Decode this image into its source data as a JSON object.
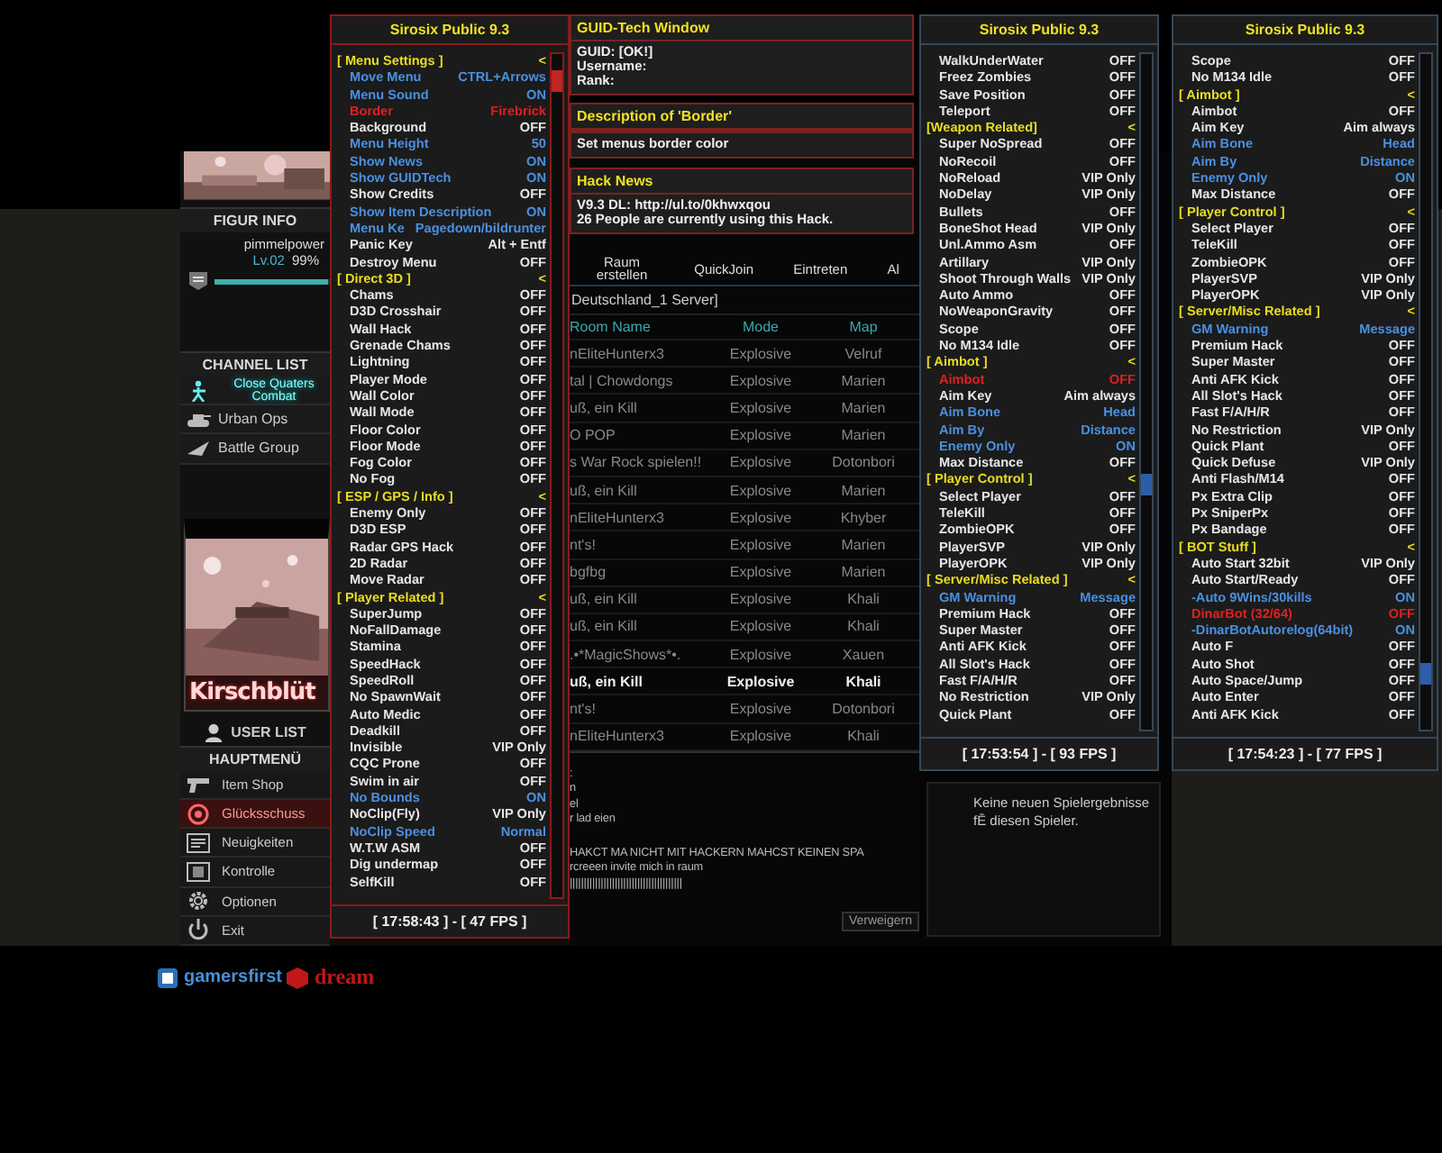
{
  "menus": [
    {
      "title": "Sirosix Public 9.3",
      "color": "#8b1a1a",
      "footer": "[ 17:58:43 ] - [ 47 FPS ]",
      "rows": [
        {
          "kind": "section",
          "label": "[ Menu Settings ]",
          "value": "<"
        },
        {
          "kind": "option",
          "label": "Move Menu",
          "value": "CTRL+Arrows",
          "active": true,
          "selected": false
        },
        {
          "kind": "option",
          "label": "Menu Sound",
          "value": "ON",
          "active": true,
          "selected": false
        },
        {
          "kind": "option",
          "label": "Border",
          "value": "Firebrick",
          "active": false,
          "selected": true
        },
        {
          "kind": "option",
          "label": "Background",
          "value": "OFF",
          "active": false,
          "selected": false
        },
        {
          "kind": "option",
          "label": "Menu Height",
          "value": "50",
          "active": true,
          "selected": false
        },
        {
          "kind": "option",
          "label": "Show News",
          "value": "ON",
          "active": true,
          "selected": false
        },
        {
          "kind": "option",
          "label": "Show GUIDTech",
          "value": "ON",
          "active": true,
          "selected": false
        },
        {
          "kind": "option",
          "label": "Show Credits",
          "value": "OFF",
          "active": false,
          "selected": false
        },
        {
          "kind": "option",
          "label": "Show Item Description",
          "value": "ON",
          "active": true,
          "selected": false
        },
        {
          "kind": "option",
          "label": "Menu Ke",
          "value": "Pagedown/bildrunter",
          "active": true,
          "selected": false
        },
        {
          "kind": "option",
          "label": "Panic Key",
          "value": "Alt + Entf",
          "active": false,
          "selected": false
        },
        {
          "kind": "option",
          "label": "Destroy Menu",
          "value": "OFF",
          "active": false,
          "selected": false
        },
        {
          "kind": "section",
          "label": "[ Direct 3D ]",
          "value": "<"
        },
        {
          "kind": "option",
          "label": "Chams",
          "value": "OFF",
          "active": false,
          "selected": false
        },
        {
          "kind": "option",
          "label": "D3D Crosshair",
          "value": "OFF",
          "active": false,
          "selected": false
        },
        {
          "kind": "option",
          "label": "Wall Hack",
          "value": "OFF",
          "active": false,
          "selected": false
        },
        {
          "kind": "option",
          "label": "Grenade Chams",
          "value": "OFF",
          "active": false,
          "selected": false
        },
        {
          "kind": "option",
          "label": "Lightning",
          "value": "OFF",
          "active": false,
          "selected": false
        },
        {
          "kind": "option",
          "label": "Player Mode",
          "value": "OFF",
          "active": false,
          "selected": false
        },
        {
          "kind": "option",
          "label": "Wall Color",
          "value": "OFF",
          "active": false,
          "selected": false
        },
        {
          "kind": "option",
          "label": "Wall Mode",
          "value": "OFF",
          "active": false,
          "selected": false
        },
        {
          "kind": "option",
          "label": "Floor Color",
          "value": "OFF",
          "active": false,
          "selected": false
        },
        {
          "kind": "option",
          "label": "Floor Mode",
          "value": "OFF",
          "active": false,
          "selected": false
        },
        {
          "kind": "option",
          "label": "Fog Color",
          "value": "OFF",
          "active": false,
          "selected": false
        },
        {
          "kind": "option",
          "label": "No Fog",
          "value": "OFF",
          "active": false,
          "selected": false
        },
        {
          "kind": "section",
          "label": "[ ESP / GPS / Info ]",
          "value": "<"
        },
        {
          "kind": "option",
          "label": "Enemy Only",
          "value": "OFF",
          "active": false,
          "selected": false
        },
        {
          "kind": "option",
          "label": "D3D ESP",
          "value": "OFF",
          "active": false,
          "selected": false
        },
        {
          "kind": "option",
          "label": "Radar GPS Hack",
          "value": "OFF",
          "active": false,
          "selected": false
        },
        {
          "kind": "option",
          "label": "2D Radar",
          "value": "OFF",
          "active": false,
          "selected": false
        },
        {
          "kind": "option",
          "label": "Move Radar",
          "value": "OFF",
          "active": false,
          "selected": false
        },
        {
          "kind": "section",
          "label": "[ Player Related ]",
          "value": "<"
        },
        {
          "kind": "option",
          "label": "SuperJump",
          "value": "OFF",
          "active": false,
          "selected": false
        },
        {
          "kind": "option",
          "label": "NoFallDamage",
          "value": "OFF",
          "active": false,
          "selected": false
        },
        {
          "kind": "option",
          "label": "Stamina",
          "value": "OFF",
          "active": false,
          "selected": false
        },
        {
          "kind": "option",
          "label": "SpeedHack",
          "value": "OFF",
          "active": false,
          "selected": false
        },
        {
          "kind": "option",
          "label": "SpeedRoll",
          "value": "OFF",
          "active": false,
          "selected": false
        },
        {
          "kind": "option",
          "label": "No SpawnWait",
          "value": "OFF",
          "active": false,
          "selected": false
        },
        {
          "kind": "option",
          "label": "Auto Medic",
          "value": "OFF",
          "active": false,
          "selected": false
        },
        {
          "kind": "option",
          "label": "Deadkill",
          "value": "OFF",
          "active": false,
          "selected": false
        },
        {
          "kind": "option",
          "label": "Invisible",
          "value": "VIP Only",
          "active": false,
          "selected": false
        },
        {
          "kind": "option",
          "label": "CQC Prone",
          "value": "OFF",
          "active": false,
          "selected": false
        },
        {
          "kind": "option",
          "label": "Swim in air",
          "value": "OFF",
          "active": false,
          "selected": false
        },
        {
          "kind": "option",
          "label": "No Bounds",
          "value": "ON",
          "active": true,
          "selected": false
        },
        {
          "kind": "option",
          "label": "NoClip(Fly)",
          "value": "VIP Only",
          "active": false,
          "selected": false
        },
        {
          "kind": "option",
          "label": "NoClip Speed",
          "value": "Normal",
          "active": true,
          "selected": false
        },
        {
          "kind": "option",
          "label": "W.T.W ASM",
          "value": "OFF",
          "active": false,
          "selected": false
        },
        {
          "kind": "option",
          "label": "Dig undermap",
          "value": "OFF",
          "active": false,
          "selected": false
        },
        {
          "kind": "option",
          "label": "SelfKill",
          "value": "OFF",
          "active": false,
          "selected": false
        }
      ]
    },
    {
      "title": "Sirosix Public 9.3",
      "color": "#34485a",
      "footer": "[ 17:53:54 ] - [ 93 FPS ]",
      "rows": [
        {
          "kind": "option",
          "label": "WalkUnderWater",
          "value": "OFF",
          "active": false,
          "selected": false
        },
        {
          "kind": "option",
          "label": "Freez Zombies",
          "value": "OFF",
          "active": false,
          "selected": false
        },
        {
          "kind": "option",
          "label": "Save Position",
          "value": "OFF",
          "active": false,
          "selected": false
        },
        {
          "kind": "option",
          "label": "Teleport",
          "value": "OFF",
          "active": false,
          "selected": false
        },
        {
          "kind": "section",
          "label": "[Weapon Related]",
          "value": "<"
        },
        {
          "kind": "option",
          "label": "Super NoSpread",
          "value": "OFF",
          "active": false,
          "selected": false
        },
        {
          "kind": "option",
          "label": "NoRecoil",
          "value": "OFF",
          "active": false,
          "selected": false
        },
        {
          "kind": "option",
          "label": "NoReload",
          "value": "VIP Only",
          "active": false,
          "selected": false
        },
        {
          "kind": "option",
          "label": "NoDelay",
          "value": "VIP Only",
          "active": false,
          "selected": false
        },
        {
          "kind": "option",
          "label": "Bullets",
          "value": "OFF",
          "active": false,
          "selected": false
        },
        {
          "kind": "option",
          "label": "BoneShot Head",
          "value": "VIP Only",
          "active": false,
          "selected": false
        },
        {
          "kind": "option",
          "label": "Unl.Ammo Asm",
          "value": "OFF",
          "active": false,
          "selected": false
        },
        {
          "kind": "option",
          "label": "Artillary",
          "value": "VIP Only",
          "active": false,
          "selected": false
        },
        {
          "kind": "option",
          "label": "Shoot Through Walls",
          "value": "VIP Only",
          "active": false,
          "selected": false
        },
        {
          "kind": "option",
          "label": "Auto Ammo",
          "value": "OFF",
          "active": false,
          "selected": false
        },
        {
          "kind": "option",
          "label": "NoWeaponGravity",
          "value": "OFF",
          "active": false,
          "selected": false
        },
        {
          "kind": "option",
          "label": "Scope",
          "value": "OFF",
          "active": false,
          "selected": false
        },
        {
          "kind": "option",
          "label": "No M134 Idle",
          "value": "OFF",
          "active": false,
          "selected": false
        },
        {
          "kind": "section",
          "label": "[ Aimbot ]",
          "value": "<"
        },
        {
          "kind": "option",
          "label": "Aimbot",
          "value": "OFF",
          "active": false,
          "selected": true
        },
        {
          "kind": "option",
          "label": "Aim Key",
          "value": "Aim always",
          "active": false,
          "selected": false
        },
        {
          "kind": "option",
          "label": "Aim Bone",
          "value": "Head",
          "active": true,
          "selected": false
        },
        {
          "kind": "option",
          "label": "Aim By",
          "value": "Distance",
          "active": true,
          "selected": false
        },
        {
          "kind": "option",
          "label": "Enemy Only",
          "value": "ON",
          "active": true,
          "selected": false
        },
        {
          "kind": "option",
          "label": "Max Distance",
          "value": "OFF",
          "active": false,
          "selected": false
        },
        {
          "kind": "section",
          "label": "[ Player Control ]",
          "value": "<"
        },
        {
          "kind": "option",
          "label": "Select Player",
          "value": "OFF",
          "active": false,
          "selected": false
        },
        {
          "kind": "option",
          "label": "TeleKill",
          "value": "OFF",
          "active": false,
          "selected": false
        },
        {
          "kind": "option",
          "label": "ZombieOPK",
          "value": "OFF",
          "active": false,
          "selected": false
        },
        {
          "kind": "option",
          "label": "PlayerSVP",
          "value": "VIP Only",
          "active": false,
          "selected": false
        },
        {
          "kind": "option",
          "label": "PlayerOPK",
          "value": "VIP Only",
          "active": false,
          "selected": false
        },
        {
          "kind": "section",
          "label": "[ Server/Misc Related ]",
          "value": "<"
        },
        {
          "kind": "option",
          "label": "GM Warning",
          "value": "Message",
          "active": true,
          "selected": false
        },
        {
          "kind": "option",
          "label": "Premium Hack",
          "value": "OFF",
          "active": false,
          "selected": false
        },
        {
          "kind": "option",
          "label": "Super Master",
          "value": "OFF",
          "active": false,
          "selected": false
        },
        {
          "kind": "option",
          "label": "Anti AFK Kick",
          "value": "OFF",
          "active": false,
          "selected": false
        },
        {
          "kind": "option",
          "label": "All Slot's Hack",
          "value": "OFF",
          "active": false,
          "selected": false
        },
        {
          "kind": "option",
          "label": "Fast F/A/H/R",
          "value": "OFF",
          "active": false,
          "selected": false
        },
        {
          "kind": "option",
          "label": "No Restriction",
          "value": "VIP Only",
          "active": false,
          "selected": false
        },
        {
          "kind": "option",
          "label": "Quick Plant",
          "value": "OFF",
          "active": false,
          "selected": false
        }
      ]
    },
    {
      "title": "Sirosix Public 9.3",
      "color": "#34485a",
      "footer": "[ 17:54:23 ] - [ 77 FPS ]",
      "rows": [
        {
          "kind": "option",
          "label": "Scope",
          "value": "OFF",
          "active": false,
          "selected": false
        },
        {
          "kind": "option",
          "label": "No M134 Idle",
          "value": "OFF",
          "active": false,
          "selected": false
        },
        {
          "kind": "section",
          "label": "[ Aimbot ]",
          "value": "<"
        },
        {
          "kind": "option",
          "label": "Aimbot",
          "value": "OFF",
          "active": false,
          "selected": false
        },
        {
          "kind": "option",
          "label": "Aim Key",
          "value": "Aim always",
          "active": false,
          "selected": false
        },
        {
          "kind": "option",
          "label": "Aim Bone",
          "value": "Head",
          "active": true,
          "selected": false
        },
        {
          "kind": "option",
          "label": "Aim By",
          "value": "Distance",
          "active": true,
          "selected": false
        },
        {
          "kind": "option",
          "label": "Enemy Only",
          "value": "ON",
          "active": true,
          "selected": false
        },
        {
          "kind": "option",
          "label": "Max Distance",
          "value": "OFF",
          "active": false,
          "selected": false
        },
        {
          "kind": "section",
          "label": "[ Player Control ]",
          "value": "<"
        },
        {
          "kind": "option",
          "label": "Select Player",
          "value": "OFF",
          "active": false,
          "selected": false
        },
        {
          "kind": "option",
          "label": "TeleKill",
          "value": "OFF",
          "active": false,
          "selected": false
        },
        {
          "kind": "option",
          "label": "ZombieOPK",
          "value": "OFF",
          "active": false,
          "selected": false
        },
        {
          "kind": "option",
          "label": "PlayerSVP",
          "value": "VIP Only",
          "active": false,
          "selected": false
        },
        {
          "kind": "option",
          "label": "PlayerOPK",
          "value": "VIP Only",
          "active": false,
          "selected": false
        },
        {
          "kind": "section",
          "label": "[ Server/Misc Related ]",
          "value": "<"
        },
        {
          "kind": "option",
          "label": "GM Warning",
          "value": "Message",
          "active": true,
          "selected": false
        },
        {
          "kind": "option",
          "label": "Premium Hack",
          "value": "OFF",
          "active": false,
          "selected": false
        },
        {
          "kind": "option",
          "label": "Super Master",
          "value": "OFF",
          "active": false,
          "selected": false
        },
        {
          "kind": "option",
          "label": "Anti AFK Kick",
          "value": "OFF",
          "active": false,
          "selected": false
        },
        {
          "kind": "option",
          "label": "All Slot's Hack",
          "value": "OFF",
          "active": false,
          "selected": false
        },
        {
          "kind": "option",
          "label": "Fast F/A/H/R",
          "value": "OFF",
          "active": false,
          "selected": false
        },
        {
          "kind": "option",
          "label": "No Restriction",
          "value": "VIP Only",
          "active": false,
          "selected": false
        },
        {
          "kind": "option",
          "label": "Quick Plant",
          "value": "OFF",
          "active": false,
          "selected": false
        },
        {
          "kind": "option",
          "label": "Quick Defuse",
          "value": "VIP Only",
          "active": false,
          "selected": false
        },
        {
          "kind": "option",
          "label": "Anti Flash/M14",
          "value": "OFF",
          "active": false,
          "selected": false
        },
        {
          "kind": "option",
          "label": "Px Extra Clip",
          "value": "OFF",
          "active": false,
          "selected": false
        },
        {
          "kind": "option",
          "label": "Px SniperPx",
          "value": "OFF",
          "active": false,
          "selected": false
        },
        {
          "kind": "option",
          "label": "Px Bandage",
          "value": "OFF",
          "active": false,
          "selected": false
        },
        {
          "kind": "section",
          "label": "[ BOT Stuff ]",
          "value": "<"
        },
        {
          "kind": "option",
          "label": "Auto Start 32bit",
          "value": "VIP Only",
          "active": false,
          "selected": false
        },
        {
          "kind": "option",
          "label": "Auto Start/Ready",
          "value": "OFF",
          "active": false,
          "selected": false
        },
        {
          "kind": "option",
          "label": "-Auto 9Wins/30kills",
          "value": "ON",
          "active": true,
          "selected": false
        },
        {
          "kind": "option",
          "label": "DinarBot (32/64)",
          "value": "OFF",
          "active": false,
          "selected": true
        },
        {
          "kind": "option",
          "label": "-DinarBotAutorelog(64bit)",
          "value": "ON",
          "active": true,
          "selected": false
        },
        {
          "kind": "option",
          "label": "Auto F",
          "value": "OFF",
          "active": false,
          "selected": false
        },
        {
          "kind": "option",
          "label": "Auto Shot",
          "value": "OFF",
          "active": false,
          "selected": false
        },
        {
          "kind": "option",
          "label": "Auto Space/Jump",
          "value": "OFF",
          "active": false,
          "selected": false
        },
        {
          "kind": "option",
          "label": "Auto Enter",
          "value": "OFF",
          "active": false,
          "selected": false
        },
        {
          "kind": "option",
          "label": "Anti AFK Kick",
          "value": "OFF",
          "active": false,
          "selected": false
        }
      ]
    }
  ],
  "guid_window": {
    "title": "GUID-Tech Window",
    "lines": [
      "GUID: [OK!]",
      "Username:",
      "Rank:"
    ]
  },
  "description": {
    "title": "Description of 'Border'",
    "text": "Set menus border color"
  },
  "news": {
    "title": "Hack News",
    "lines": [
      "V9.3 DL: http://ul.to/0khwxqou",
      "26 People are currently using this Hack."
    ]
  },
  "game": {
    "figure_info": {
      "title": "FIGUR INFO",
      "player": "pimmelpower",
      "rank": "Lv.02",
      "percent": "99%",
      "level": 0.99
    },
    "channel_list": {
      "title": "CHANNEL LIST",
      "items": [
        {
          "label": "Close Quaters Combat",
          "selected": true
        },
        {
          "label": "Urban Ops",
          "selected": false
        },
        {
          "label": "Battle Group",
          "selected": false
        }
      ]
    },
    "banner_label": "Kirschblüt",
    "user_list": "USER LIST",
    "main_menu": {
      "title": "HAUPTMENÜ",
      "items": [
        {
          "label": "Item Shop",
          "selected": false
        },
        {
          "label": "Glücksschuss",
          "selected": true
        },
        {
          "label": "Neuigkeiten",
          "selected": false
        },
        {
          "label": "Kontrolle",
          "selected": false
        },
        {
          "label": "Optionen",
          "selected": false
        },
        {
          "label": "Exit",
          "selected": false
        }
      ]
    },
    "room_buttons": [
      "Raum erstellen",
      "QuickJoin",
      "Eintreten",
      "Al"
    ],
    "server": "Deutschland_1 Server]",
    "columns": [
      "Room Name",
      "Mode",
      "Map"
    ],
    "rooms": [
      {
        "name": "nEliteHunterx3",
        "mode": "Explosive",
        "map": "Velruf",
        "selected": false
      },
      {
        "name": "tal | Chowdongs",
        "mode": "Explosive",
        "map": "Marien",
        "selected": false
      },
      {
        "name": "uß, ein Kill",
        "mode": "Explosive",
        "map": "Marien",
        "selected": false
      },
      {
        "name": "O POP",
        "mode": "Explosive",
        "map": "Marien",
        "selected": false
      },
      {
        "name": "s War Rock spielen!!",
        "mode": "Explosive",
        "map": "Dotonbori",
        "selected": false
      },
      {
        "name": "uß, ein Kill",
        "mode": "Explosive",
        "map": "Marien",
        "selected": false
      },
      {
        "name": "nEliteHunterx3",
        "mode": "Explosive",
        "map": "Khyber",
        "selected": false
      },
      {
        "name": "nt's!",
        "mode": "Explosive",
        "map": "Marien",
        "selected": false
      },
      {
        "name": "bgfbg",
        "mode": "Explosive",
        "map": "Marien",
        "selected": false
      },
      {
        "name": "uß, ein Kill",
        "mode": "Explosive",
        "map": "Khali",
        "selected": false
      },
      {
        "name": "uß, ein Kill",
        "mode": "Explosive",
        "map": "Khali",
        "selected": false
      },
      {
        "name": ".•*MagicShows*•.",
        "mode": "Explosive",
        "map": "Xauen",
        "selected": false
      },
      {
        "name": "uß, ein Kill",
        "mode": "Explosive",
        "map": "Khali",
        "selected": true
      },
      {
        "name": "nt's!",
        "mode": "Explosive",
        "map": "Dotonbori",
        "selected": false
      },
      {
        "name": "nEliteHunterx3",
        "mode": "Explosive",
        "map": "Khali",
        "selected": false
      }
    ],
    "chat": [
      ":",
      "n",
      "el",
      "r lad eien",
      "HAKCT MA NICHT MIT HACKERN MAHCST KEINEN SPA",
      "rcreeen invite mich in raum",
      "||||||||||||||||||||||||||||||||||||||||"
    ],
    "decline_button": "Verweigern",
    "results_text": "Keine neuen Spielergebnisse fĒ diesen Spieler."
  },
  "footer": {
    "publisher": "gamersfirst",
    "developer": "dream"
  }
}
